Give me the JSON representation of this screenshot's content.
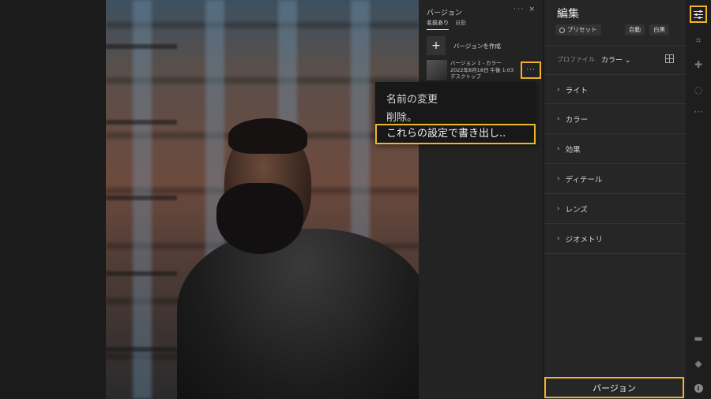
{
  "versions_panel": {
    "title": "バージョン",
    "controls": "··· ×",
    "tabs": [
      {
        "label": "名前あり",
        "active": true
      },
      {
        "label": "自動",
        "active": false
      }
    ],
    "create_label": "バージョンを作成",
    "version_item": {
      "name": "バージョン 1 - カラー",
      "date": "2022年8月18日 午後 1:03",
      "source": "デスクトップ",
      "more": "···"
    }
  },
  "context_menu": {
    "items": [
      "名前の変更",
      "削除。",
      "これらの設定で書き出し.."
    ]
  },
  "edit_panel": {
    "title": "編集",
    "preset_label": "プリセット",
    "auto_label": "自動",
    "bw_label": "白黒",
    "profile_label": "プロファイル",
    "profile_value": "カラー",
    "sections": [
      "ライト",
      "カラー",
      "効果",
      "ディテール",
      "レンズ",
      "ジオメトリ"
    ],
    "version_button": "バージョン"
  },
  "toolbar": {
    "icons": [
      "edit-sliders-icon",
      "crop-icon",
      "healing-icon",
      "masking-icon",
      "more-icon",
      "comment-icon",
      "tag-icon",
      "info-icon"
    ]
  },
  "colors": {
    "highlight": "#f0b42a",
    "panel_bg": "#262626",
    "versions_bg": "#232323"
  }
}
